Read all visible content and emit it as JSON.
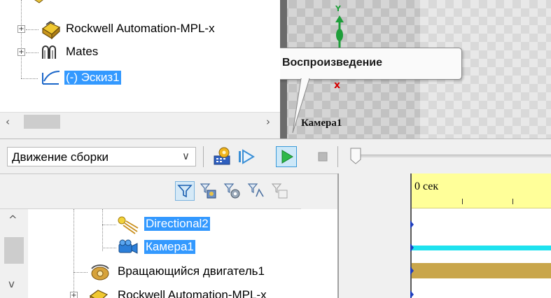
{
  "feature_tree": {
    "items": [
      {
        "label": "Rockwell Automation-MPL-x",
        "icon": "assembly-icon",
        "expander": "+"
      },
      {
        "label": "Mates",
        "icon": "mates-icon",
        "expander": "+"
      },
      {
        "label": "(-) Эскиз1",
        "icon": "sketch-icon",
        "selected": true
      }
    ],
    "scroll_left": "‹",
    "scroll_right": "›"
  },
  "viewport": {
    "axis_label": "Y",
    "marker": "x",
    "camera_label": "Камера1",
    "tooltip": "Воспроизведение"
  },
  "motion_toolbar": {
    "study_type": "Движение сборки",
    "study_type_chevron": "∨",
    "buttons": [
      "calculate-icon",
      "play-from-start-icon",
      "play-icon",
      "stop-icon"
    ],
    "active_button": "play-icon"
  },
  "motion_tree": {
    "filter_buttons": [
      "filter-animated-icon",
      "filter-driving-icon",
      "filter-selected-icon",
      "filter-results-icon",
      "filter-disabled-icon"
    ],
    "items": [
      {
        "label": "Directional2",
        "icon": "directional-light-icon",
        "selected": true
      },
      {
        "label": "Камера1",
        "icon": "camera-icon",
        "selected": true
      },
      {
        "label": "Вращающийся двигатель1",
        "icon": "rotary-motor-icon",
        "selected": false
      },
      {
        "label": "Rockwell Automation-MPL-x",
        "icon": "assembly-icon",
        "selected": false
      }
    ],
    "scroll_up": "^",
    "scroll_down": "v"
  },
  "timeline": {
    "time_label": "0 сек"
  },
  "colors": {
    "selection": "#3399ff",
    "timeline_header": "#ffff99",
    "camera_bar": "#1ee2ef",
    "motor_bar": "#c9a64b",
    "play_green": "#2db84a"
  }
}
